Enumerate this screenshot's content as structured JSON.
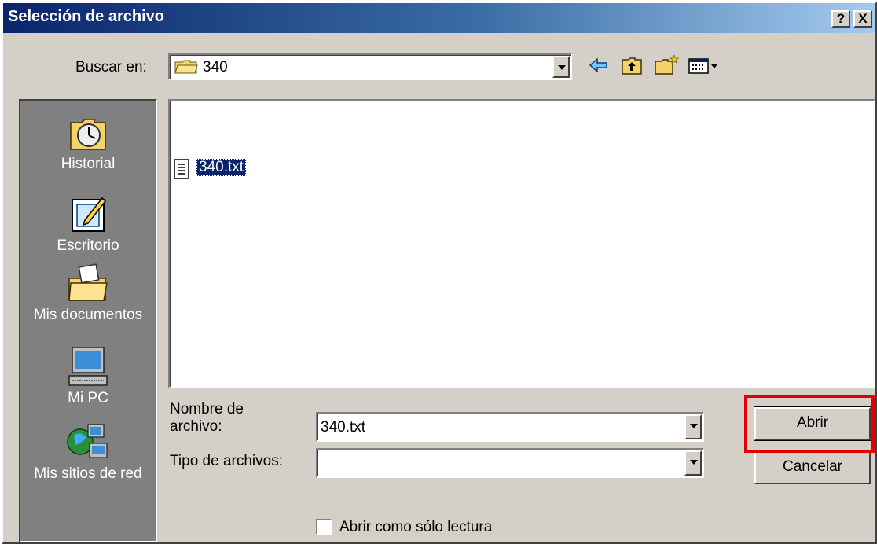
{
  "dialog": {
    "title": "Selección de archivo",
    "help_label": "?",
    "close_label": "X"
  },
  "lookin": {
    "label": "Buscar en:",
    "value": "340",
    "icon": "folder-icon"
  },
  "toolbar": {
    "icons": [
      "back-arrow-icon",
      "up-one-level-icon",
      "new-folder-icon",
      "view-menu-icon"
    ]
  },
  "places": [
    {
      "label": "Historial",
      "icon": "history-icon"
    },
    {
      "label": "Escritorio",
      "icon": "desktop-icon"
    },
    {
      "label": "Mis documentos",
      "icon": "my-documents-icon"
    },
    {
      "label": "Mi PC",
      "icon": "my-computer-icon"
    },
    {
      "label": "Mis sitios de red",
      "icon": "network-places-icon"
    }
  ],
  "files": [
    {
      "name": "340.txt",
      "icon": "text-file-icon",
      "selected": true
    }
  ],
  "filename": {
    "label_line1": "Nombre de",
    "label_line2": "archivo:",
    "value": "340.txt"
  },
  "filetype": {
    "label": "Tipo de archivos:",
    "value": ""
  },
  "buttons": {
    "open": "Abrir",
    "cancel": "Cancelar"
  },
  "readonly": {
    "label": "Abrir como sólo lectura",
    "checked": false
  },
  "colors": {
    "title_start": "#0a246a",
    "title_end": "#a6caf0",
    "face": "#d4d0c8",
    "selection": "#0a246a",
    "highlight_box": "#e00000"
  }
}
